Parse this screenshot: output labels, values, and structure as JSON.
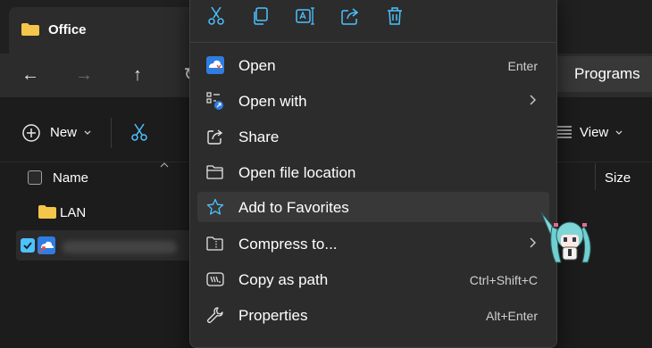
{
  "window": {
    "tab_title": "Office",
    "breadcrumb": "Programs"
  },
  "toolbar": {
    "new_label": "New",
    "view_label": "View"
  },
  "columns": {
    "name": "Name",
    "size": "Size"
  },
  "files": [
    {
      "name": "LAN",
      "icon": "folder-icon"
    }
  ],
  "menu": {
    "quick_actions": [
      "cut-icon",
      "copy-icon",
      "rename-icon",
      "share-icon",
      "delete-icon"
    ],
    "items": [
      {
        "label": "Open",
        "shortcut": "Enter",
        "icon": "cloud-app-icon"
      },
      {
        "label": "Open with",
        "shortcut": "",
        "icon": "open-with-icon"
      },
      {
        "label": "Share",
        "shortcut": "",
        "icon": "share-icon"
      },
      {
        "label": "Open file location",
        "shortcut": "",
        "icon": "folder-outline-icon"
      },
      {
        "label": "Add to Favorites",
        "shortcut": "",
        "icon": "star-icon"
      },
      {
        "label": "Compress to...",
        "shortcut": "",
        "icon": "zip-folder-icon"
      },
      {
        "label": "Copy as path",
        "shortcut": "Ctrl+Shift+C",
        "icon": "copy-path-icon"
      },
      {
        "label": "Properties",
        "shortcut": "Alt+Enter",
        "icon": "wrench-icon"
      }
    ]
  },
  "colors": {
    "accent": "#4cc2ff",
    "folder": "#f4c64a",
    "menu_bg": "#2c2c2c"
  }
}
